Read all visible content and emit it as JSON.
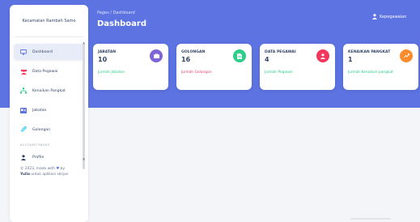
{
  "sidebar": {
    "brand": "Kecamatan Rambah Samo",
    "items": [
      {
        "label": "Dashboard",
        "icon": "monitor-icon"
      },
      {
        "label": "Data Pegawai",
        "icon": "users-icon"
      },
      {
        "label": "Kenaikan Pangkat",
        "icon": "hierarchy-icon"
      },
      {
        "label": "Jabatan",
        "icon": "id-card-icon"
      },
      {
        "label": "Golongan",
        "icon": "paperclip-icon"
      }
    ],
    "section_label": "ACCOUNT PAGES",
    "profile_label": "Profile",
    "footer_prefix": "© 2023, made with ",
    "footer_by": " by",
    "footer_author": "Yulia",
    "footer_suffix": " untuk aplikasi skripsi"
  },
  "header": {
    "breadcrumb": "Pages / Dashboard",
    "title": "Dashboard",
    "user": "Kepegawaian"
  },
  "cards": [
    {
      "label": "JABATAN",
      "value": "10",
      "link": "Jumlah Jabatan",
      "link_color": "#2dce89",
      "icon": "briefcase-icon",
      "icon_color": "#7f63d8"
    },
    {
      "label": "GOLONGAN",
      "value": "16",
      "link": "Jumlah Golongan",
      "link_color": "#e33e6f",
      "icon": "file-icon",
      "icon_color": "#2dce89"
    },
    {
      "label": "DATA PEGAWAI",
      "value": "4",
      "link": "Jumlah Pegawai",
      "link_color": "#2dce89",
      "icon": "user-icon",
      "icon_color": "#f5365c"
    },
    {
      "label": "KENAIKAN PANGKAT",
      "value": "1",
      "link": "Jumlah Kenaikan pangkat",
      "link_color": "#2dce89",
      "icon": "chart-icon",
      "icon_color": "#fb8c2e"
    }
  ],
  "colors": {
    "hero": "#5c73e1",
    "heart": "#5e72e4"
  }
}
